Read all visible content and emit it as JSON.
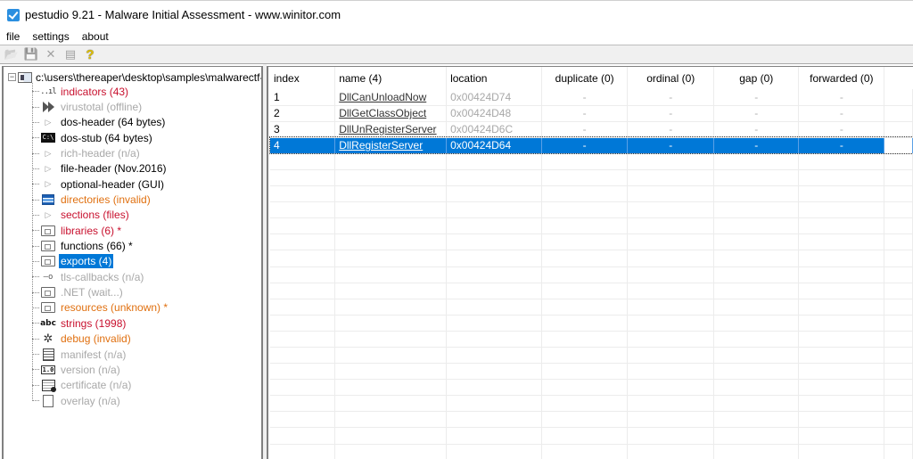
{
  "window": {
    "title": "pestudio 9.21 - Malware Initial Assessment - www.winitor.com",
    "icon": "checkbox-app-icon"
  },
  "menu": [
    "file",
    "settings",
    "about"
  ],
  "toolbar": [
    {
      "name": "open-icon",
      "glyph": "📂",
      "enabled": false
    },
    {
      "name": "save-icon",
      "glyph": "💾",
      "enabled": false
    },
    {
      "name": "close-file-icon",
      "glyph": "✕",
      "enabled": false
    },
    {
      "name": "clipboard-icon",
      "glyph": "▤",
      "enabled": false
    },
    {
      "name": "help-icon",
      "glyph": "?",
      "enabled": true
    }
  ],
  "tree": {
    "root": {
      "expander": "−",
      "label": "c:\\users\\thereaper\\desktop\\samples\\malwarectf-"
    },
    "items": [
      {
        "label": "indicators (43)",
        "icon": "bar-chart-icon",
        "color": "red"
      },
      {
        "label": "virustotal (offline)",
        "icon": "virustotal-icon",
        "color": "gray"
      },
      {
        "label": "dos-header (64 bytes)",
        "icon": "expand-triangle-icon",
        "color": "black"
      },
      {
        "label": "dos-stub (64 bytes)",
        "icon": "console-icon",
        "color": "black"
      },
      {
        "label": "rich-header (n/a)",
        "icon": "expand-triangle-icon",
        "color": "gray"
      },
      {
        "label": "file-header (Nov.2016)",
        "icon": "expand-triangle-icon",
        "color": "black"
      },
      {
        "label": "optional-header (GUI)",
        "icon": "expand-triangle-icon",
        "color": "black"
      },
      {
        "label": "directories (invalid)",
        "icon": "directories-icon",
        "color": "orange"
      },
      {
        "label": "sections (files)",
        "icon": "expand-triangle-icon",
        "color": "red"
      },
      {
        "label": "libraries (6) *",
        "icon": "libraries-icon",
        "color": "red"
      },
      {
        "label": "functions (66) *",
        "icon": "functions-icon",
        "color": "black"
      },
      {
        "label": "exports (4)",
        "icon": "exports-icon",
        "color": "black",
        "selected": true
      },
      {
        "label": "tls-callbacks (n/a)",
        "icon": "key-icon",
        "color": "gray"
      },
      {
        "label": ".NET (wait...)",
        "icon": "dotnet-icon",
        "color": "gray"
      },
      {
        "label": "resources (unknown) *",
        "icon": "resources-icon",
        "color": "orange"
      },
      {
        "label": "strings (1998)",
        "icon": "abc-icon",
        "color": "red"
      },
      {
        "label": "debug (invalid)",
        "icon": "bug-icon",
        "color": "orange"
      },
      {
        "label": "manifest (n/a)",
        "icon": "manifest-icon",
        "color": "gray"
      },
      {
        "label": "version (n/a)",
        "icon": "version-icon",
        "color": "gray"
      },
      {
        "label": "certificate (n/a)",
        "icon": "certificate-icon",
        "color": "gray"
      },
      {
        "label": "overlay (n/a)",
        "icon": "document-icon",
        "color": "gray"
      }
    ]
  },
  "table": {
    "columns": [
      "index",
      "name (4)",
      "location",
      "duplicate (0)",
      "ordinal (0)",
      "gap (0)",
      "forwarded (0)"
    ],
    "rows": [
      {
        "index": "1",
        "name": "DllCanUnloadNow",
        "location": "0x00424D74",
        "duplicate": "-",
        "ordinal": "-",
        "gap": "-",
        "forwarded": "-"
      },
      {
        "index": "2",
        "name": "DllGetClassObject",
        "location": "0x00424D48",
        "duplicate": "-",
        "ordinal": "-",
        "gap": "-",
        "forwarded": "-"
      },
      {
        "index": "3",
        "name": "DllUnRegisterServer",
        "location": "0x00424D6C",
        "duplicate": "-",
        "ordinal": "-",
        "gap": "-",
        "forwarded": "-"
      },
      {
        "index": "4",
        "name": "DllRegisterServer",
        "location": "0x00424D64",
        "duplicate": "-",
        "ordinal": "-",
        "gap": "-",
        "forwarded": "-",
        "selected": true
      }
    ]
  },
  "colors": {
    "selection": "#0078d7",
    "red": "#c8102e",
    "orange": "#e07010",
    "gray": "#a8a8a8"
  }
}
